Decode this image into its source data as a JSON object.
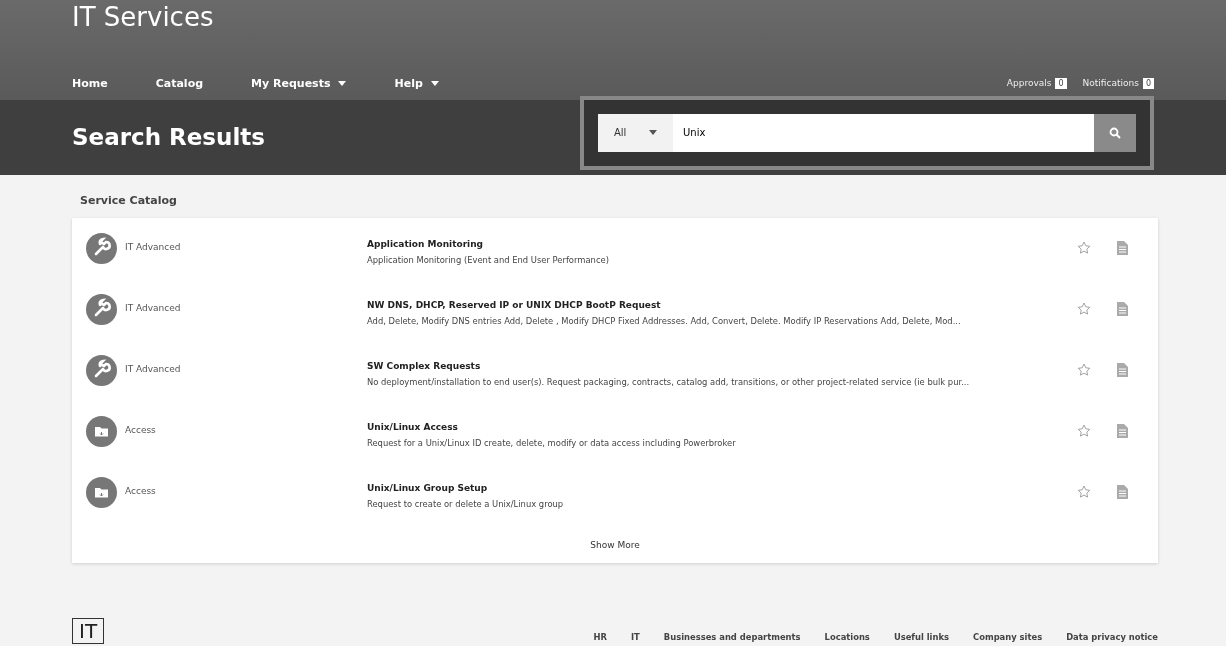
{
  "header": {
    "title": "IT Services",
    "nav": [
      {
        "label": "Home",
        "dropdown": false
      },
      {
        "label": "Catalog",
        "dropdown": false
      },
      {
        "label": "My Requests",
        "dropdown": true
      },
      {
        "label": "Help",
        "dropdown": true
      }
    ],
    "counters": [
      {
        "label": "Approvals",
        "count": "0"
      },
      {
        "label": "Notifications",
        "count": "0"
      }
    ]
  },
  "page_title": "Search Results",
  "search": {
    "scope": "All",
    "value": "Unix"
  },
  "section_title": "Service Catalog",
  "results": [
    {
      "kind": "wrench",
      "category": "IT Advanced",
      "title": "Application Monitoring",
      "description": "Application Monitoring (Event and End User Performance)"
    },
    {
      "kind": "wrench",
      "category": "IT Advanced",
      "title": "NW DNS, DHCP, Reserved IP or UNIX DHCP BootP Request",
      "description": "Add, Delete, Modify DNS entries Add, Delete , Modify DHCP Fixed Addresses. Add, Convert, Delete. Modify IP Reservations Add, Delete, Mod..."
    },
    {
      "kind": "wrench",
      "category": "IT Advanced",
      "title": "SW Complex Requests",
      "description": "No deployment/installation to end user(s). Request packaging, contracts, catalog add, transitions, or other project-related service (ie  bulk pur..."
    },
    {
      "kind": "folder",
      "category": "Access",
      "title": "Unix/Linux Access",
      "description": "Request for a Unix/Linux ID create, delete, modify or data access including Powerbroker"
    },
    {
      "kind": "folder",
      "category": "Access",
      "title": "Unix/Linux Group Setup",
      "description": "Request to create or delete a Unix/Linux group"
    }
  ],
  "show_more": "Show More",
  "footer": {
    "logo": "IT",
    "links": [
      "HR",
      "IT",
      "Businesses and departments",
      "Locations",
      "Useful links",
      "Company sites",
      "Data privacy notice"
    ]
  }
}
